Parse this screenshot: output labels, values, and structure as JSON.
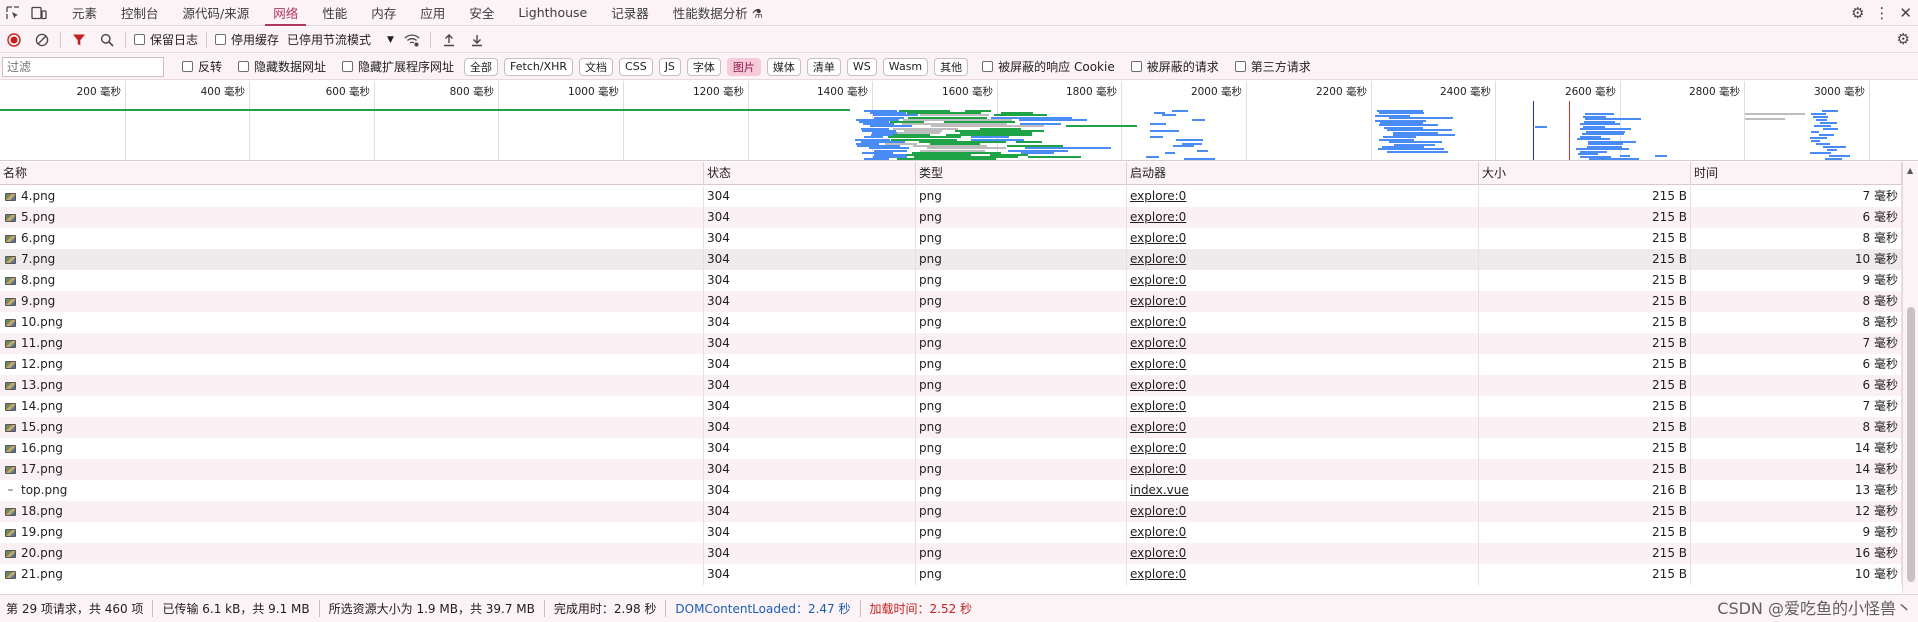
{
  "tabbar": {
    "tabs": [
      {
        "label": "元素"
      },
      {
        "label": "控制台"
      },
      {
        "label": "源代码/来源"
      },
      {
        "label": "网络"
      },
      {
        "label": "性能"
      },
      {
        "label": "内存"
      },
      {
        "label": "应用"
      },
      {
        "label": "安全"
      },
      {
        "label": "Lighthouse"
      },
      {
        "label": "记录器"
      },
      {
        "label": "性能数据分析 ⚗"
      }
    ],
    "active_tab": "网络"
  },
  "toolbar": {
    "preserve_log_label": "保留日志",
    "disable_cache_label": "停用缓存",
    "throttling_value": "已停用节流模式"
  },
  "filterbar": {
    "filter_placeholder": "过滤",
    "invert_label": "反转",
    "hide_data_urls_label": "隐藏数据网址",
    "hide_extension_urls_label": "隐藏扩展程序网址",
    "type_filters": [
      "全部",
      "Fetch/XHR",
      "文档",
      "CSS",
      "JS",
      "字体",
      "图片",
      "媒体",
      "清单",
      "WS",
      "Wasm",
      "其他"
    ],
    "active_type": "图片",
    "blocked_cookies_label": "被屏蔽的响应 Cookie",
    "blocked_requests_label": "被屏蔽的请求",
    "third_party_label": "第三方请求"
  },
  "overview": {
    "ticks": [
      "200 毫秒",
      "400 毫秒",
      "600 毫秒",
      "800 毫秒",
      "1000 毫秒",
      "1200 毫秒",
      "1400 毫秒",
      "1600 毫秒",
      "1800 毫秒",
      "2000 毫秒",
      "2200 毫秒",
      "2400 毫秒",
      "2600 毫秒",
      "2800 毫秒",
      "3000 毫秒"
    ],
    "colors": {
      "html": "#1ea446",
      "image": "#4a8cf6",
      "waiting": "#bdbdbd",
      "dom_content_loaded": "#2030c0",
      "load": "#d93025"
    }
  },
  "table": {
    "columns": [
      "名称",
      "状态",
      "类型",
      "启动器",
      "大小",
      "时间"
    ],
    "rows": [
      {
        "name": "4.png",
        "status": "304",
        "type": "png",
        "initiator": "explore:0",
        "size": "215 B",
        "time": "7 毫秒"
      },
      {
        "name": "5.png",
        "status": "304",
        "type": "png",
        "initiator": "explore:0",
        "size": "215 B",
        "time": "6 毫秒"
      },
      {
        "name": "6.png",
        "status": "304",
        "type": "png",
        "initiator": "explore:0",
        "size": "215 B",
        "time": "8 毫秒"
      },
      {
        "name": "7.png",
        "status": "304",
        "type": "png",
        "initiator": "explore:0",
        "size": "215 B",
        "time": "10 毫秒"
      },
      {
        "name": "8.png",
        "status": "304",
        "type": "png",
        "initiator": "explore:0",
        "size": "215 B",
        "time": "9 毫秒"
      },
      {
        "name": "9.png",
        "status": "304",
        "type": "png",
        "initiator": "explore:0",
        "size": "215 B",
        "time": "8 毫秒"
      },
      {
        "name": "10.png",
        "status": "304",
        "type": "png",
        "initiator": "explore:0",
        "size": "215 B",
        "time": "8 毫秒"
      },
      {
        "name": "11.png",
        "status": "304",
        "type": "png",
        "initiator": "explore:0",
        "size": "215 B",
        "time": "7 毫秒"
      },
      {
        "name": "12.png",
        "status": "304",
        "type": "png",
        "initiator": "explore:0",
        "size": "215 B",
        "time": "6 毫秒"
      },
      {
        "name": "13.png",
        "status": "304",
        "type": "png",
        "initiator": "explore:0",
        "size": "215 B",
        "time": "6 毫秒"
      },
      {
        "name": "14.png",
        "status": "304",
        "type": "png",
        "initiator": "explore:0",
        "size": "215 B",
        "time": "7 毫秒"
      },
      {
        "name": "15.png",
        "status": "304",
        "type": "png",
        "initiator": "explore:0",
        "size": "215 B",
        "time": "8 毫秒"
      },
      {
        "name": "16.png",
        "status": "304",
        "type": "png",
        "initiator": "explore:0",
        "size": "215 B",
        "time": "14 毫秒"
      },
      {
        "name": "17.png",
        "status": "304",
        "type": "png",
        "initiator": "explore:0",
        "size": "215 B",
        "time": "14 毫秒"
      },
      {
        "name": "top.png",
        "status": "304",
        "type": "png",
        "initiator": "index.vue",
        "size": "216 B",
        "time": "13 毫秒"
      },
      {
        "name": "18.png",
        "status": "304",
        "type": "png",
        "initiator": "explore:0",
        "size": "215 B",
        "time": "12 毫秒"
      },
      {
        "name": "19.png",
        "status": "304",
        "type": "png",
        "initiator": "explore:0",
        "size": "215 B",
        "time": "9 毫秒"
      },
      {
        "name": "20.png",
        "status": "304",
        "type": "png",
        "initiator": "explore:0",
        "size": "215 B",
        "time": "16 毫秒"
      },
      {
        "name": "21.png",
        "status": "304",
        "type": "png",
        "initiator": "explore:0",
        "size": "215 B",
        "time": "10 毫秒"
      }
    ]
  },
  "status": {
    "requests": "第 29 项请求，共 460 项",
    "transferred": "已传输 6.1 kB，共 9.1 MB",
    "resources": "所选资源大小为 1.9 MB，共 39.7 MB",
    "finish": "完成用时：2.98 秒",
    "dom_content_loaded": "DOMContentLoaded：2.47 秒",
    "load": "加载时间：2.52 秒"
  },
  "watermark": "CSDN @爱吃鱼的小怪兽丶"
}
